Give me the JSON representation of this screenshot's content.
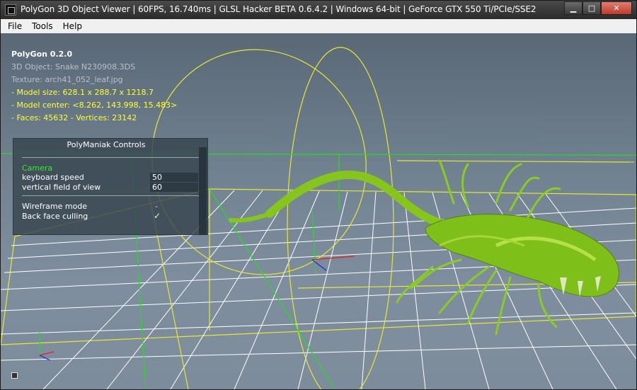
{
  "window": {
    "title": "PolyGon 3D Object Viewer | 60FPS, 16.740ms | GLSL Hacker BETA 0.6.4.2 | Windows 64-bit | GeForce GTX 550 Ti/PCIe/SSE2",
    "icon": "app-icon",
    "buttons": {
      "minimize": "▁",
      "maximize": "□",
      "close": "✕"
    }
  },
  "menu": {
    "file": "File",
    "tools": "Tools",
    "help": "Help"
  },
  "overlay": {
    "app_version": "PolyGon 0.2.0",
    "object": "3D Object: Snake N230908.3DS",
    "texture": "Texture: arch41_052_leaf.jpg",
    "model_size": "- Model size:  628.1 x 288.7 x 1218.7",
    "model_center": "- Model center:  <8.262, 143.998, 15.483>",
    "faces_vertices": "- Faces: 45632 - Vertices: 23142"
  },
  "controls": {
    "title": "PolyManiak Controls",
    "section_camera": "Camera",
    "keyboard_speed_label": "keyboard speed",
    "keyboard_speed_value": "50",
    "fov_label": "vertical field of view",
    "fov_value": "60",
    "wireframe_label": "Wireframe mode",
    "wireframe_value": "-",
    "backface_label": "Back face culling",
    "backface_value": "✓"
  },
  "colors": {
    "overlay_highlight": "#ffff33",
    "section_header": "#39e639",
    "grid": "#ffffff",
    "bbox": "#e8e830",
    "axis_green": "#22dd22",
    "model": "#7fbf1a"
  }
}
